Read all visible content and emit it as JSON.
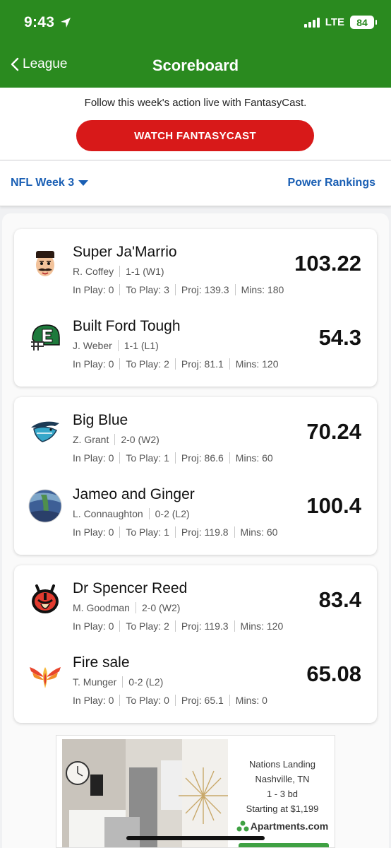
{
  "status_bar": {
    "time": "9:43",
    "network": "LTE",
    "battery": "84"
  },
  "nav": {
    "back_label": "League",
    "title": "Scoreboard"
  },
  "promo": {
    "text": "Follow this week's action live with FantasyCast.",
    "button_label": "WATCH FANTASYCAST"
  },
  "filters": {
    "week": "NFL Week 3",
    "power_rankings": "Power Rankings"
  },
  "matchups": [
    {
      "teams": [
        {
          "name": "Super Ja'Marrio",
          "owner": "R. Coffey",
          "record": "1-1 (W1)",
          "in_play": "In Play: 0",
          "to_play": "To Play: 3",
          "proj": "Proj: 139.3",
          "mins": "Mins: 180",
          "score": "103.22",
          "logo": "mustache-man-icon"
        },
        {
          "name": "Built Ford Tough",
          "owner": "J. Weber",
          "record": "1-1 (L1)",
          "in_play": "In Play: 0",
          "to_play": "To Play: 2",
          "proj": "Proj: 81.1",
          "mins": "Mins: 120",
          "score": "54.3",
          "logo": "football-helmet-icon"
        }
      ]
    },
    {
      "teams": [
        {
          "name": "Big Blue",
          "owner": "Z. Grant",
          "record": "2-0 (W2)",
          "in_play": "In Play: 0",
          "to_play": "To Play: 1",
          "proj": "Proj: 86.6",
          "mins": "Mins: 60",
          "score": "70.24",
          "logo": "shark-icon"
        },
        {
          "name": "Jameo and Ginger",
          "owner": "L. Connaughton",
          "record": "0-2 (L2)",
          "in_play": "In Play: 0",
          "to_play": "To Play: 1",
          "proj": "Proj: 119.8",
          "mins": "Mins: 60",
          "score": "100.4",
          "logo": "blue-photo-avatar"
        }
      ]
    },
    {
      "teams": [
        {
          "name": "Dr Spencer Reed",
          "owner": "M. Goodman",
          "record": "2-0 (W2)",
          "in_play": "In Play: 0",
          "to_play": "To Play: 2",
          "proj": "Proj: 119.3",
          "mins": "Mins: 120",
          "score": "83.4",
          "logo": "devil-icon"
        },
        {
          "name": "Fire sale",
          "owner": "T. Munger",
          "record": "0-2 (L2)",
          "in_play": "In Play: 0",
          "to_play": "To Play: 0",
          "proj": "Proj: 65.1",
          "mins": "Mins: 0",
          "score": "65.08",
          "logo": "phoenix-icon"
        }
      ]
    }
  ],
  "ad": {
    "line1": "Nations Landing",
    "line2": "Nashville, TN",
    "line3": "1 - 3 bd",
    "line4": "Starting at $1,199",
    "brand": "Apartments.com"
  },
  "colors": {
    "header_green": "#2a8a1f",
    "cta_red": "#d81919",
    "link_blue": "#1a5fb4"
  }
}
